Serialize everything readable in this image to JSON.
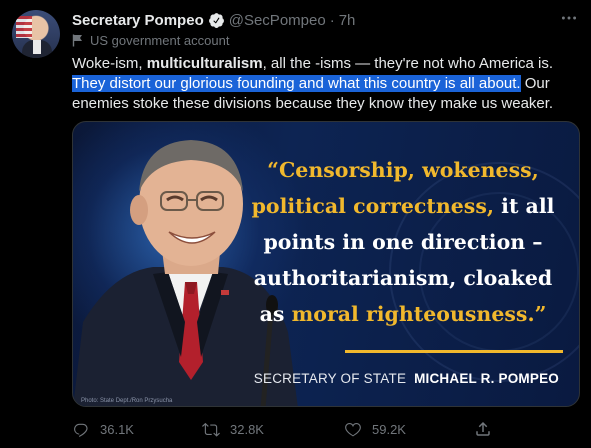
{
  "author": {
    "display_name": "Secretary Pompeo",
    "handle": "@SecPompeo",
    "separator": "·",
    "time": "7h",
    "label": "US government account"
  },
  "tweet": {
    "part1": "Woke-ism, ",
    "bold1": "multiculturalism",
    "part2": ", all the -isms — they're not who America is. ",
    "highlighted": "They distort our glorious founding and what this country is all about.",
    "part3": " Our enemies stoke these divisions because they know they make us weaker."
  },
  "media": {
    "quote_open": "“Censorship, wokeness,",
    "quote_line2_gold": "political correctness,",
    "quote_line2_white": " it all",
    "quote_line3": "points in one direction –",
    "quote_line4": "authoritarianism, cloaked",
    "quote_line5_white": "as ",
    "quote_line5_gold": "moral righteousness.",
    "quote_close": "”",
    "attribution_title": "SECRETARY OF STATE",
    "attribution_name": "MICHAEL R. POMPEO",
    "photo_credit": "Photo: State Dept./Ron Przysucha"
  },
  "actions": {
    "replies": "36.1K",
    "retweets": "32.8K",
    "likes": "59.2K"
  },
  "colors": {
    "highlight": "#1a63d8",
    "gold": "#f1b82d",
    "muted": "#71767b",
    "verified": "#e7e9ea"
  },
  "icons": [
    "more-icon",
    "verified-icon",
    "government-flag-icon",
    "reply-icon",
    "retweet-icon",
    "like-icon",
    "share-icon"
  ]
}
